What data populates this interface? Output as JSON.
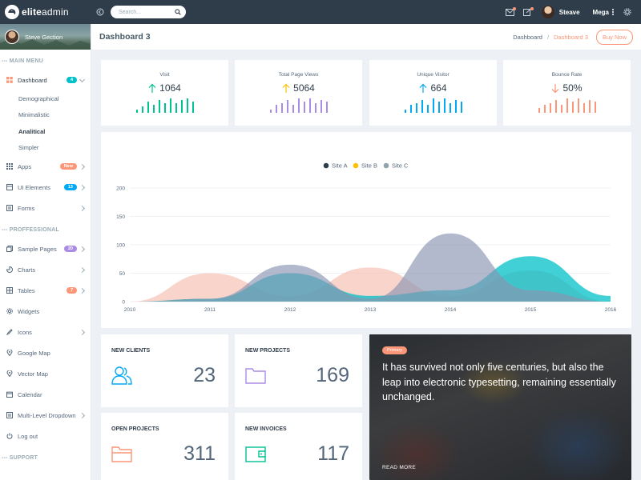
{
  "app": {
    "logo_bold": "elite",
    "logo_thin": "admin"
  },
  "topbar": {
    "search_placeholder": "Search...",
    "user_name": "Steave",
    "mega_label": "Mega"
  },
  "sidebar": {
    "profile_name": "Steve Gection",
    "main_menu_label": "--- MAIN MENU",
    "dashboard": {
      "label": "Dashboard",
      "badge": "4",
      "badge_color": "#01c0c8"
    },
    "dashboard_sub": [
      "Demographical",
      "Minimalistic",
      "Analitical",
      "Simpler"
    ],
    "main_items": [
      {
        "label": "Apps",
        "badge": "New",
        "badge_color": "#fb9678",
        "icon": "grid-icon"
      },
      {
        "label": "UI Elements",
        "badge": "13",
        "badge_color": "#03a9f3",
        "icon": "layers-icon"
      },
      {
        "label": "Forms",
        "badge": "",
        "icon": "list-icon"
      }
    ],
    "professional_label": "--- PROFFESSIONAL",
    "pro_items": [
      {
        "label": "Sample Pages",
        "badge": "20",
        "badge_color": "#ab8ce4",
        "icon": "copy-icon"
      },
      {
        "label": "Charts",
        "badge": "",
        "icon": "chart-icon"
      },
      {
        "label": "Tables",
        "badge": "7",
        "badge_color": "#fb9678",
        "icon": "table-icon"
      },
      {
        "label": "Widgets",
        "badge": "",
        "icon": "gear-icon"
      },
      {
        "label": "Icons",
        "badge": "",
        "icon": "pen-icon"
      },
      {
        "label": "Google Map",
        "badge": "",
        "icon": "pin-icon"
      },
      {
        "label": "Vector Map",
        "badge": "",
        "icon": "pin-icon"
      },
      {
        "label": "Calendar",
        "badge": "",
        "icon": "calendar-icon"
      },
      {
        "label": "Multi-Level Dropdown",
        "badge": "",
        "icon": "menu-icon"
      },
      {
        "label": "Log out",
        "badge": "",
        "icon": "power-icon"
      }
    ],
    "support_label": "--- SUPPORT"
  },
  "header": {
    "title": "Dashboard 3",
    "breadcrumb": [
      "Dashboard",
      "Dashboard 3"
    ],
    "buy_label": "Buy Now"
  },
  "stats": [
    {
      "label": "Visit",
      "value": "1064",
      "direction": "up",
      "color": "#00c292",
      "bars": [
        2,
        4,
        7,
        5,
        8,
        6,
        9,
        6,
        8,
        9,
        7
      ]
    },
    {
      "label": "Total Page Views",
      "value": "5064",
      "direction": "up",
      "color": "#ab8ce4",
      "arrow_color": "#fec107",
      "bars": [
        2,
        5,
        6,
        8,
        5,
        9,
        7,
        9,
        6,
        8,
        7
      ]
    },
    {
      "label": "Unique Visitor",
      "value": "664",
      "direction": "up",
      "color": "#03a9f3",
      "bars": [
        2,
        5,
        6,
        8,
        5,
        9,
        7,
        9,
        6,
        8,
        7
      ]
    },
    {
      "label": "Bounce Rate",
      "value": "50%",
      "direction": "down",
      "color": "#fb9678",
      "arrow_color": "#fb9678",
      "bars": [
        3,
        5,
        6,
        8,
        5,
        9,
        7,
        9,
        6,
        8,
        7
      ]
    }
  ],
  "chart_data": {
    "type": "area",
    "x": [
      "2010",
      "2011",
      "2012",
      "2013",
      "2014",
      "2015",
      "2016"
    ],
    "y_ticks": [
      "0",
      "50",
      "100",
      "150",
      "200"
    ],
    "ylim": [
      0,
      200
    ],
    "legend_position": "top-center",
    "series": [
      {
        "name": "Site A",
        "color": "#f5c2b3",
        "values": [
          0,
          50,
          10,
          60,
          10,
          55,
          0
        ]
      },
      {
        "name": "Site B",
        "color": "#01c0c8",
        "values": [
          0,
          5,
          50,
          10,
          20,
          80,
          10
        ]
      },
      {
        "name": "Site C",
        "color": "#8a94b0",
        "values": [
          0,
          5,
          65,
          5,
          120,
          20,
          0
        ]
      }
    ],
    "legend_colors": [
      "#2f3d4a",
      "#fec107",
      "#90a4ae"
    ]
  },
  "cards": [
    {
      "title": "NEW CLIENTS",
      "value": "23",
      "icon": "users-icon",
      "color": "#03a9f3"
    },
    {
      "title": "NEW PROJECTS",
      "value": "169",
      "icon": "folder-icon",
      "color": "#ab8ce4"
    },
    {
      "title": "OPEN PROJECTS",
      "value": "311",
      "icon": "folder-open-icon",
      "color": "#fb9678"
    },
    {
      "title": "NEW INVOICES",
      "value": "117",
      "icon": "wallet-icon",
      "color": "#00c292"
    }
  ],
  "feature": {
    "tag": "Primary",
    "text": "It has survived not only five centuries, but also the leap into electronic typesetting, remaining essentially unchanged.",
    "read_more": "READ MORE"
  }
}
